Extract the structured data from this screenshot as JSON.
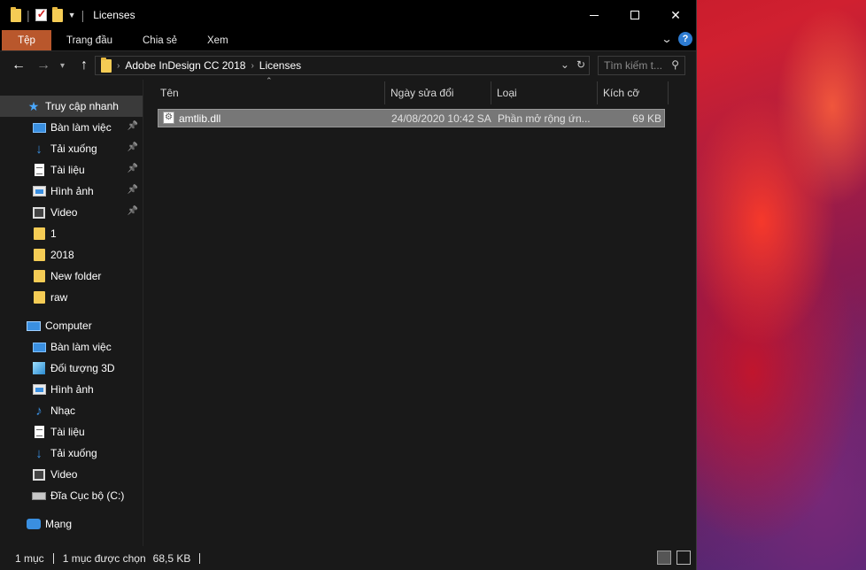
{
  "window": {
    "title": "Licenses"
  },
  "ribbon": {
    "tabs": [
      {
        "label": "Tệp"
      },
      {
        "label": "Trang đầu"
      },
      {
        "label": "Chia sẻ"
      },
      {
        "label": "Xem"
      }
    ],
    "help_label": "?"
  },
  "address": {
    "breadcrumbs": [
      "Adobe InDesign CC 2018",
      "Licenses"
    ]
  },
  "search": {
    "placeholder": "Tìm kiếm t..."
  },
  "nav": {
    "quick_access_label": "Truy cập nhanh",
    "quick_items": [
      {
        "label": "Bàn làm việc",
        "icon": "desktop-icon",
        "pinned": true
      },
      {
        "label": "Tải xuống",
        "icon": "download-icon",
        "pinned": true
      },
      {
        "label": "Tài liệu",
        "icon": "document-icon",
        "pinned": true
      },
      {
        "label": "Hình ảnh",
        "icon": "picture-icon",
        "pinned": true
      },
      {
        "label": "Video",
        "icon": "video-icon",
        "pinned": true
      },
      {
        "label": "1",
        "icon": "folder-icon",
        "pinned": false
      },
      {
        "label": "2018",
        "icon": "folder-icon",
        "pinned": false
      },
      {
        "label": "New folder",
        "icon": "folder-icon",
        "pinned": false
      },
      {
        "label": "raw",
        "icon": "folder-icon",
        "pinned": false
      }
    ],
    "computer_label": "Computer",
    "computer_items": [
      {
        "label": "Bàn làm việc",
        "icon": "desktop-icon"
      },
      {
        "label": "Đối tượng 3D",
        "icon": "3d-objects-icon"
      },
      {
        "label": "Hình ảnh",
        "icon": "picture-icon"
      },
      {
        "label": "Nhạc",
        "icon": "music-icon"
      },
      {
        "label": "Tài liệu",
        "icon": "document-icon"
      },
      {
        "label": "Tải xuống",
        "icon": "download-icon"
      },
      {
        "label": "Video",
        "icon": "video-icon"
      },
      {
        "label": "Đĩa Cục bộ (C:)",
        "icon": "drive-icon"
      }
    ],
    "network_label": "Mạng"
  },
  "columns": {
    "name": "Tên",
    "date": "Ngày sửa đổi",
    "type": "Loại",
    "size": "Kích cỡ"
  },
  "files": [
    {
      "name": "amtlib.dll",
      "date": "24/08/2020 10:42 SA",
      "type": "Phần mở rộng ứn...",
      "size": "69 KB"
    }
  ],
  "status": {
    "count": "1 mục",
    "selected": "1 mục được chọn",
    "size": "68,5 KB"
  }
}
